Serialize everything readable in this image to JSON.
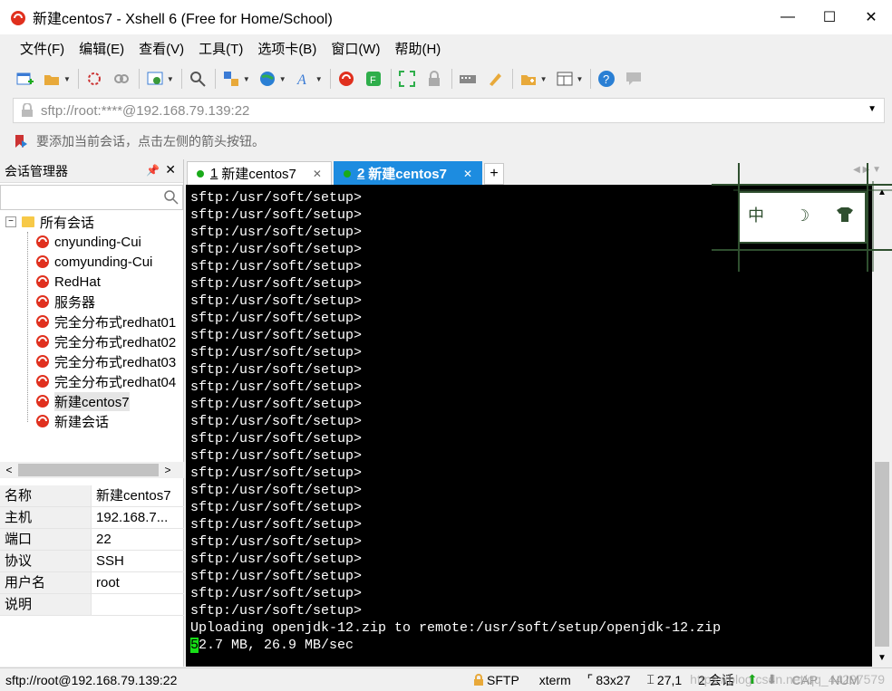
{
  "window": {
    "title": "新建centos7 - Xshell 6 (Free for Home/School)",
    "minimize": "—",
    "maximize": "☐",
    "close": "✕"
  },
  "menu": [
    "文件(F)",
    "编辑(E)",
    "查看(V)",
    "工具(T)",
    "选项卡(B)",
    "窗口(W)",
    "帮助(H)"
  ],
  "address": {
    "value": "sftp://root:****@192.168.79.139:22"
  },
  "hint": "要添加当前会话，点击左侧的箭头按钮。",
  "session_manager": {
    "title": "会话管理器",
    "pin": "ᵖ",
    "close": "✕",
    "root": "所有会话",
    "expander": "−",
    "items": [
      "cnyunding-Cui",
      "comyunding-Cui",
      "RedHat",
      "服务器",
      "完全分布式redhat01",
      "完全分布式redhat02",
      "完全分布式redhat03",
      "完全分布式redhat04",
      "新建centos7",
      "新建会话"
    ],
    "selected": "新建centos7"
  },
  "properties": [
    {
      "key": "名称",
      "value": "新建centos7"
    },
    {
      "key": "主机",
      "value": "192.168.7..."
    },
    {
      "key": "端口",
      "value": "22"
    },
    {
      "key": "协议",
      "value": "SSH"
    },
    {
      "key": "用户名",
      "value": "root"
    },
    {
      "key": "说明",
      "value": ""
    }
  ],
  "tabs": [
    {
      "num": "1",
      "label": "新建centos7",
      "active": false
    },
    {
      "num": "2",
      "label": "新建centos7",
      "active": true
    }
  ],
  "tab_add": "+",
  "terminal": {
    "prompt": "sftp:/usr/soft/setup>",
    "prompt_count": 25,
    "upload_line": "Uploading openjdk-12.zip to remote:/usr/soft/setup/openjdk-12.zip",
    "progress_cursor": "5",
    "progress_rest": "2.7 MB, 26.9 MB/sec"
  },
  "ime": {
    "lang": "中",
    "moon": "☽",
    "shirt": "👕"
  },
  "status": {
    "left": "sftp://root@192.168.79.139:22",
    "protocol": "SFTP",
    "term": "xterm",
    "size": "83x27",
    "pos": "27,1",
    "sessions": "2 会话",
    "cap": "CAP",
    "num": "NUM",
    "watermark": "https://blog.csdn.net/qq_44297579"
  },
  "colors": {
    "tab_active": "#1d8ce0",
    "cursor": "#18e018",
    "terminal_bg": "#000000",
    "session_icon": "#e0301e"
  }
}
